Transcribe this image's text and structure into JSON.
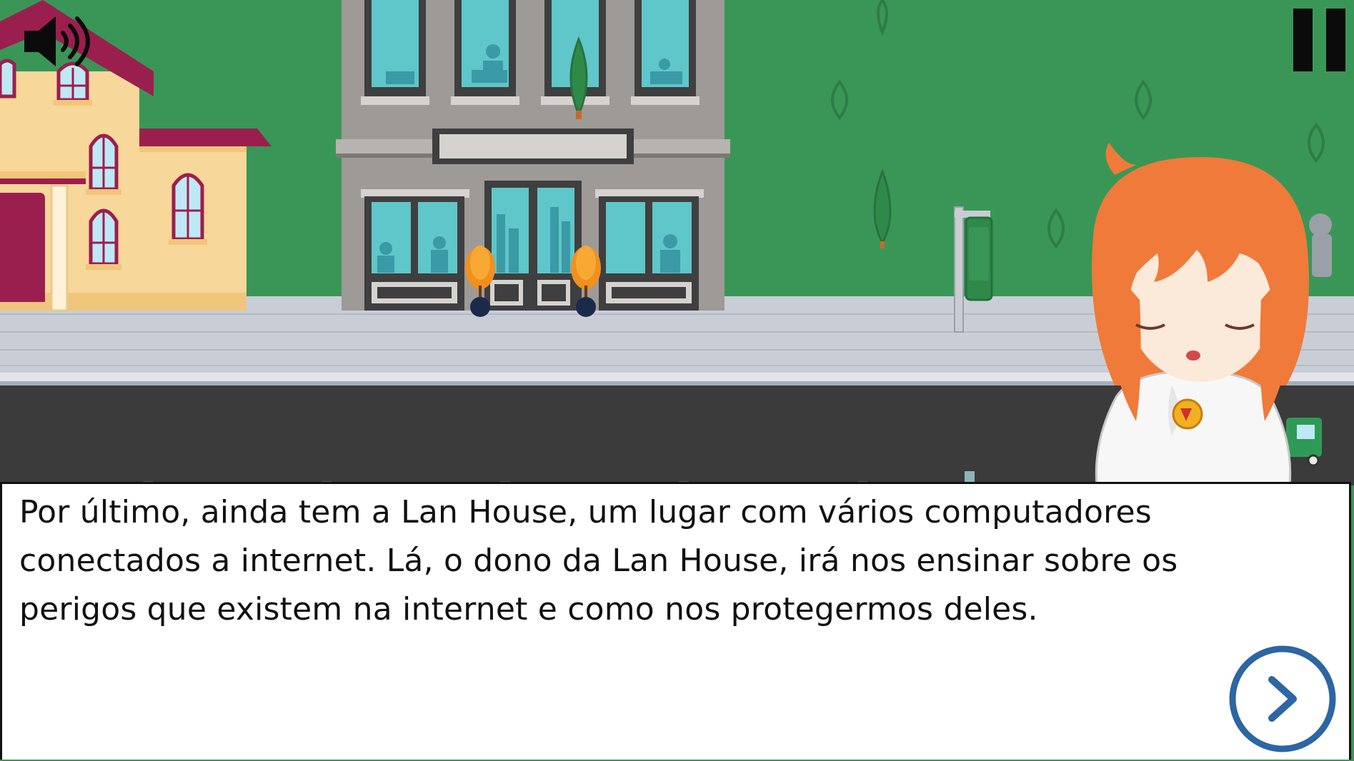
{
  "dialog": {
    "text": "Por último, ainda tem a Lan House, um lugar com vários computadores conectados a internet. Lá, o dono da Lan House, irá nos ensinar sobre os perigos que existem na internet e como nos protegermos deles."
  },
  "hud": {
    "sound_icon": "speaker-icon",
    "pause_icon": "pause-icon",
    "next_icon": "chevron-right-circle-icon"
  },
  "colors": {
    "grass": "#3a9656",
    "sidewalk": "#c9ced6",
    "road": "#3b3b3b",
    "next_button": "#2c66a3",
    "house_roof": "#9b1f4e",
    "house_wall": "#f7d79a",
    "building": "#9e9a98",
    "window": "#5fc6c9",
    "character_hair": "#f07a3a"
  }
}
